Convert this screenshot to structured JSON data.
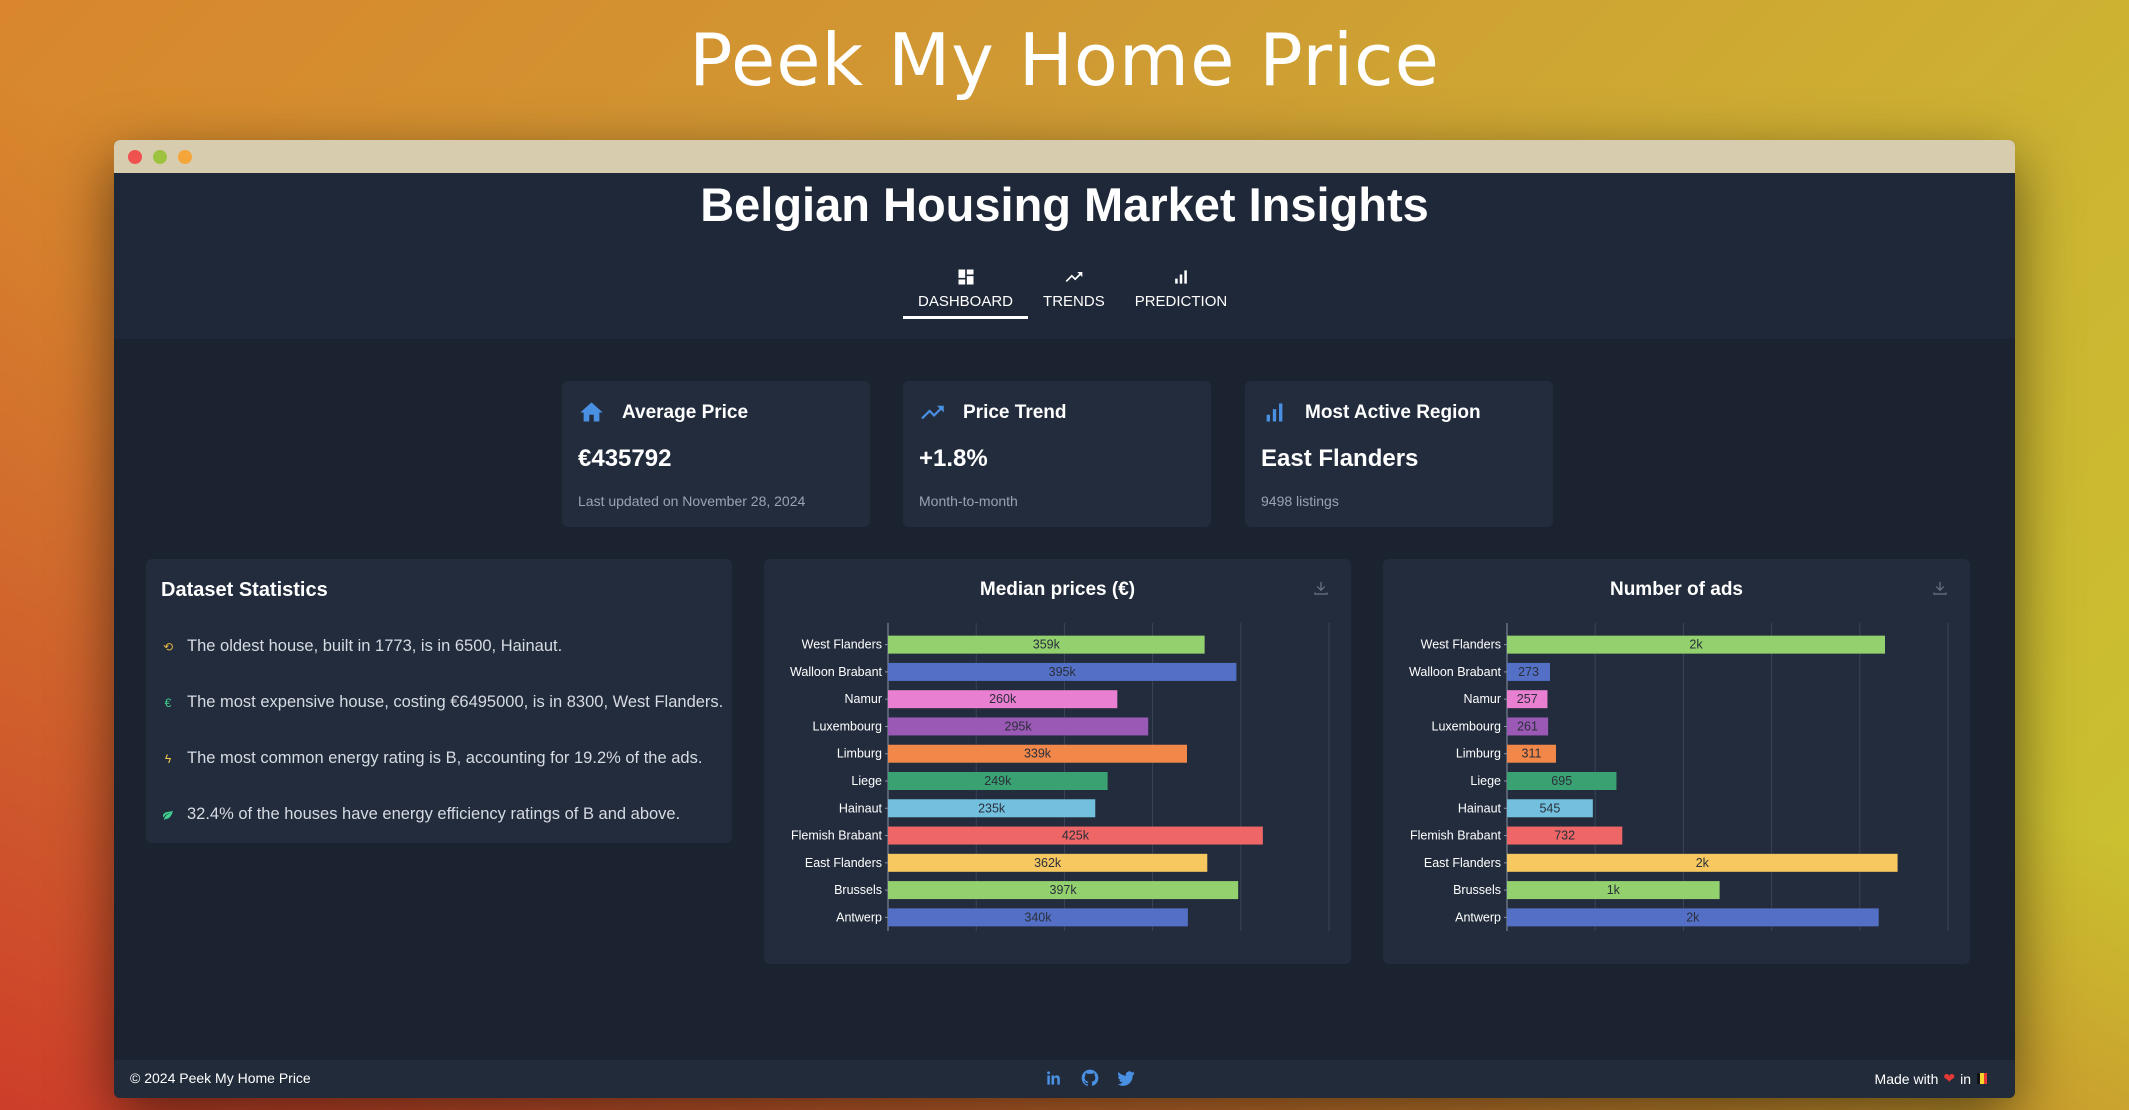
{
  "site": {
    "title": "Peek My Home Price"
  },
  "app": {
    "title": "Belgian Housing Market Insights"
  },
  "tabs": [
    {
      "label": "DASHBOARD",
      "icon": "dashboard-icon",
      "active": true
    },
    {
      "label": "TRENDS",
      "icon": "trending-up-icon",
      "active": false
    },
    {
      "label": "PREDICTION",
      "icon": "bar-chart-icon",
      "active": false
    }
  ],
  "kpis": {
    "avg_price": {
      "title": "Average Price",
      "value": "€435792",
      "sub": "Last updated on November 28, 2024",
      "icon": "home-icon"
    },
    "price_trend": {
      "title": "Price Trend",
      "value": "+1.8%",
      "sub": "Month-to-month",
      "icon": "trending-up-icon"
    },
    "active_region": {
      "title": "Most Active Region",
      "value": "East Flanders",
      "sub": "9498 listings",
      "icon": "bar-chart-icon"
    }
  },
  "stats": {
    "title": "Dataset Statistics",
    "items": [
      {
        "icon": "history-icon",
        "text": "The oldest house, built in 1773, is in 6500, Hainaut.",
        "color": "#e3b341"
      },
      {
        "icon": "euro-icon",
        "text": "The most expensive house, costing €6495000, is in 8300, West Flanders.",
        "color": "#3ecf8e"
      },
      {
        "icon": "bolt-icon",
        "text": "The most common energy rating is B, accounting for 19.2% of the ads.",
        "color": "#f2c94c"
      },
      {
        "icon": "leaf-icon",
        "text": "32.4% of the houses have energy efficiency ratings of B and above.",
        "color": "#3ecf8e"
      }
    ]
  },
  "colors": {
    "accent": "#4a90e2",
    "bars": [
      "#93d06e",
      "#5470c6",
      "#e87fd0",
      "#9b59b6",
      "#f2874a",
      "#3aa173",
      "#73c0de",
      "#ee6666",
      "#f6c85f",
      "#93d06e",
      "#5470c6"
    ]
  },
  "chart_data": [
    {
      "type": "bar",
      "orientation": "horizontal",
      "title": "Median prices (€)",
      "categories": [
        "West Flanders",
        "Walloon Brabant",
        "Namur",
        "Luxembourg",
        "Limburg",
        "Liege",
        "Hainaut",
        "Flemish Brabant",
        "East Flanders",
        "Brussels",
        "Antwerp"
      ],
      "values": [
        359000,
        395000,
        260000,
        295000,
        339000,
        249000,
        235000,
        425000,
        362000,
        397000,
        340000
      ],
      "labels": [
        "359k",
        "395k",
        "260k",
        "295k",
        "339k",
        "249k",
        "235k",
        "425k",
        "362k",
        "397k",
        "340k"
      ],
      "xlim": [
        0,
        500000
      ],
      "grid": true
    },
    {
      "type": "bar",
      "orientation": "horizontal",
      "title": "Number of ads",
      "categories": [
        "West Flanders",
        "Walloon Brabant",
        "Namur",
        "Luxembourg",
        "Limburg",
        "Liege",
        "Hainaut",
        "Flemish Brabant",
        "East Flanders",
        "Brussels",
        "Antwerp"
      ],
      "values": [
        2400,
        273,
        257,
        261,
        311,
        695,
        545,
        732,
        2480,
        1350,
        2360
      ],
      "labels": [
        "2k",
        "273",
        "257",
        "261",
        "311",
        "695",
        "545",
        "732",
        "2k",
        "1k",
        "2k"
      ],
      "xlim": [
        0,
        2800
      ],
      "grid": true
    }
  ],
  "footer": {
    "copyright": "© 2024 Peek My Home Price",
    "made_with": "Made with",
    "in": "in"
  }
}
